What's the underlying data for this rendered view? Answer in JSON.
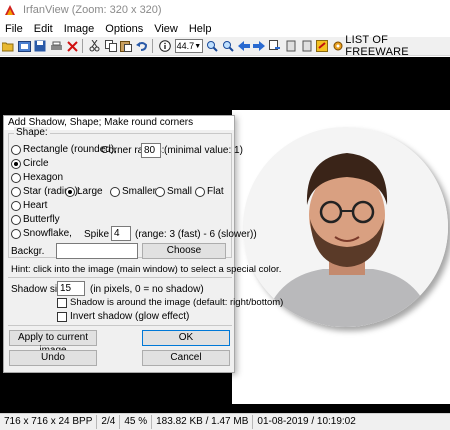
{
  "window": {
    "title": "IrfanView (Zoom: 320 x 320)"
  },
  "menu": [
    "File",
    "Edit",
    "Image",
    "Options",
    "View",
    "Help"
  ],
  "toolbar": {
    "zoom_value": "44.7",
    "banner": "LIST OF FREEWARE"
  },
  "dialog": {
    "title": "Add Shadow, Shape; Make round corners",
    "shape_group": "Shape:",
    "rect_label": "Rectangle (rounded),",
    "corner_label": "Corner radius:",
    "corner_value": "80",
    "corner_hint": "(minimal value: 1)",
    "circle_label": "Circle",
    "hexagon_label": "Hexagon",
    "star_label": "Star (radius):",
    "large_label": "Large",
    "smaller_label": "Smaller",
    "small_label": "Small",
    "flat_label": "Flat",
    "heart_label": "Heart",
    "butterfly_label": "Butterfly",
    "snowflake_label": "Snowflake,",
    "spike_label": "Spike",
    "spike_value": "4",
    "spike_hint": "(range: 3 (fast) - 6 (slower))",
    "backgr_label": "Backgr.",
    "choose_label": "Choose",
    "hint": "Hint: click into the image (main window) to select a special color.",
    "shadow_size_label": "Shadow size:",
    "shadow_size_value": "15",
    "shadow_size_hint": "(in pixels, 0 = no shadow)",
    "shadow_around_label": "Shadow is around the image (default: right/bottom)",
    "invert_label": "Invert shadow (glow effect)",
    "apply_label": "Apply to current image",
    "ok_label": "OK",
    "undo_label": "Undo",
    "cancel_label": "Cancel"
  },
  "statusbar": [
    "716 x 716 x 24 BPP",
    "2/4",
    "45 %",
    "183.82 KB / 1.47 MB",
    "01-08-2019 / 10:19:02"
  ]
}
